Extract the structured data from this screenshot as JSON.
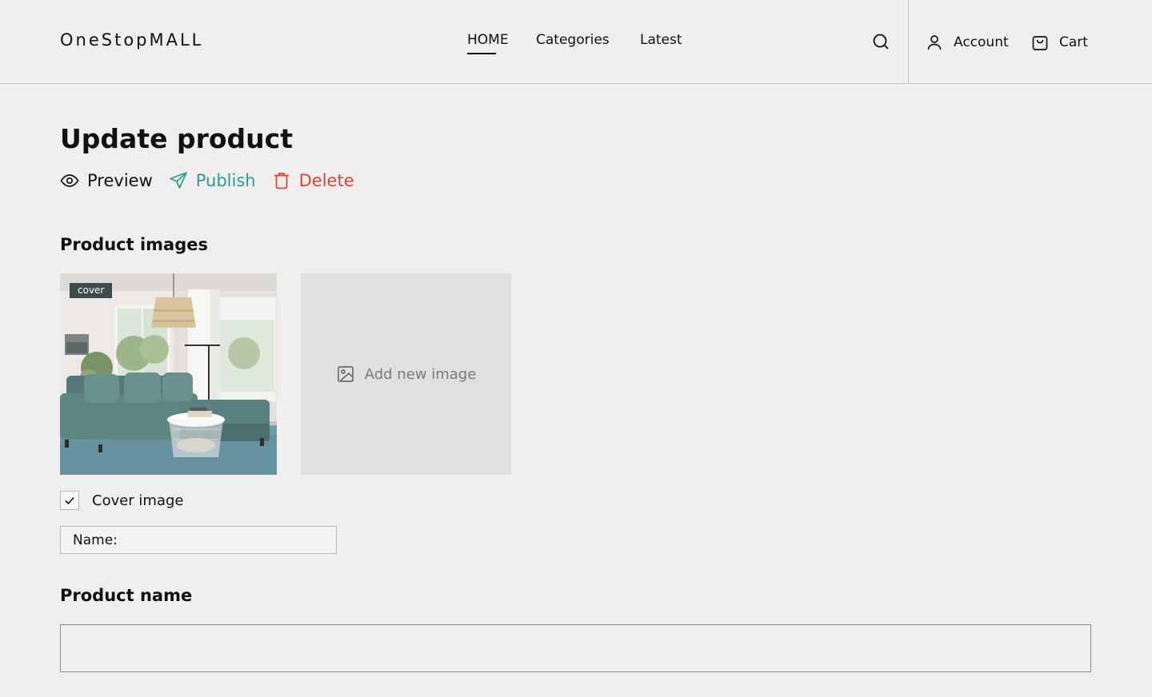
{
  "header": {
    "brand": "OneStopMALL",
    "nav": [
      {
        "label": "HOME",
        "active": true
      },
      {
        "label": "Categories",
        "active": false
      },
      {
        "label": "Latest",
        "active": false
      }
    ],
    "search_icon": "search-icon",
    "account_label": "Account",
    "cart_label": "Cart"
  },
  "main": {
    "title": "Update product",
    "actions": {
      "preview": "Preview",
      "publish": "Publish",
      "delete": "Delete"
    },
    "product_images": {
      "label": "Product images",
      "cover_badge": "cover",
      "add_new_image": "Add new image",
      "cover_checkbox_label": "Cover image",
      "cover_checked": true,
      "name_label": "Name:",
      "name_value": ""
    },
    "product_name": {
      "label": "Product name",
      "value": ""
    }
  },
  "colors": {
    "background": "#f1eeef",
    "publish": "#2a9d8f",
    "delete": "#d9432f",
    "badge": "#3e4a4c"
  }
}
